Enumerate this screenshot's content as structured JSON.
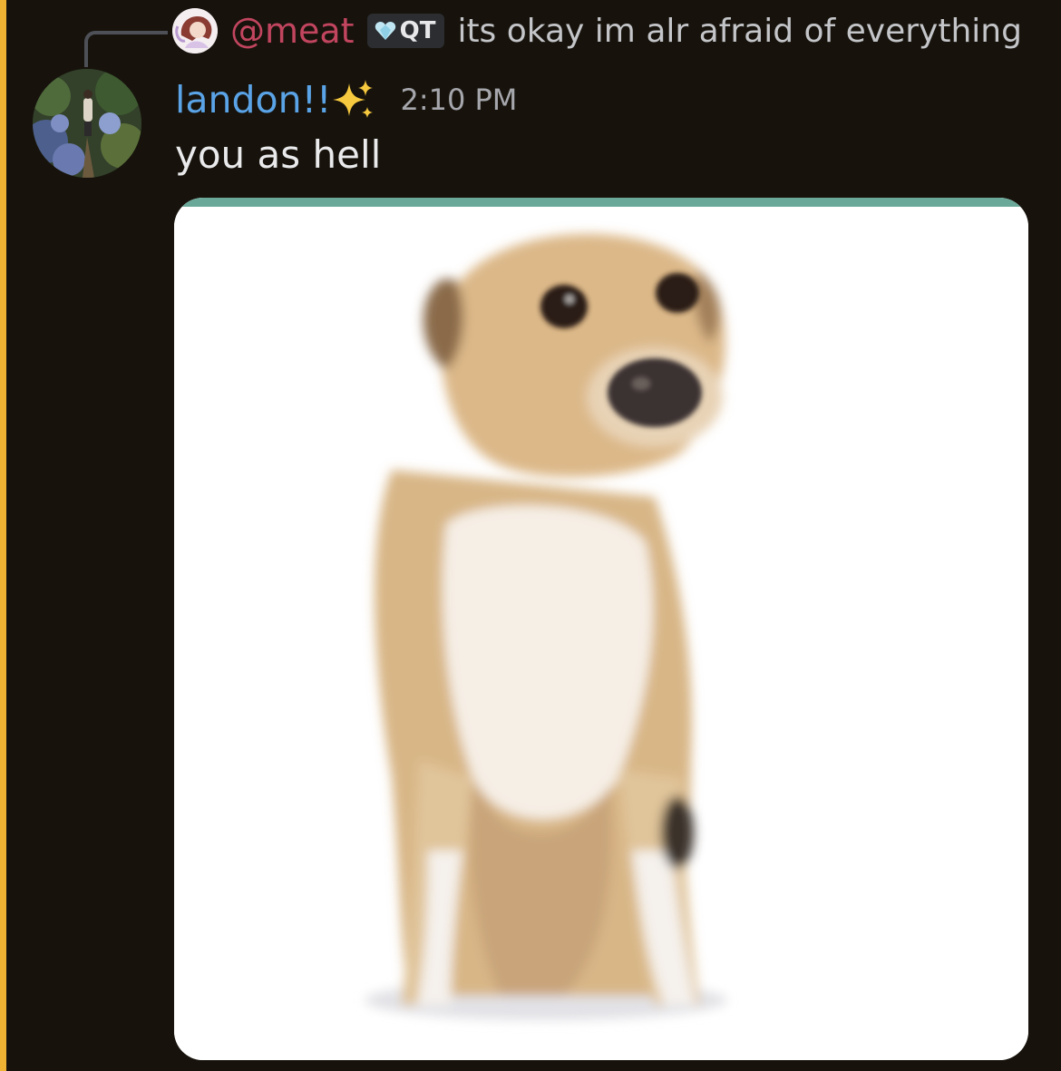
{
  "reply": {
    "author": "@meat",
    "tag": "QT",
    "text": "its okay im alr afraid of everything"
  },
  "message": {
    "author": "landon!!",
    "author_emoji": "sparkles-icon",
    "timestamp": "2:10 PM",
    "text": "you as hell"
  },
  "attachment": {
    "kind": "image",
    "subject": "dog-photo"
  },
  "colors": {
    "background": "#17130c",
    "accent_bar": "#f0b232",
    "reply_author": "#c2455f",
    "author": "#5aa3e6",
    "tag_background": "#2b2d31",
    "timestamp": "#a6a7ad",
    "message_text": "#eaeaec"
  }
}
